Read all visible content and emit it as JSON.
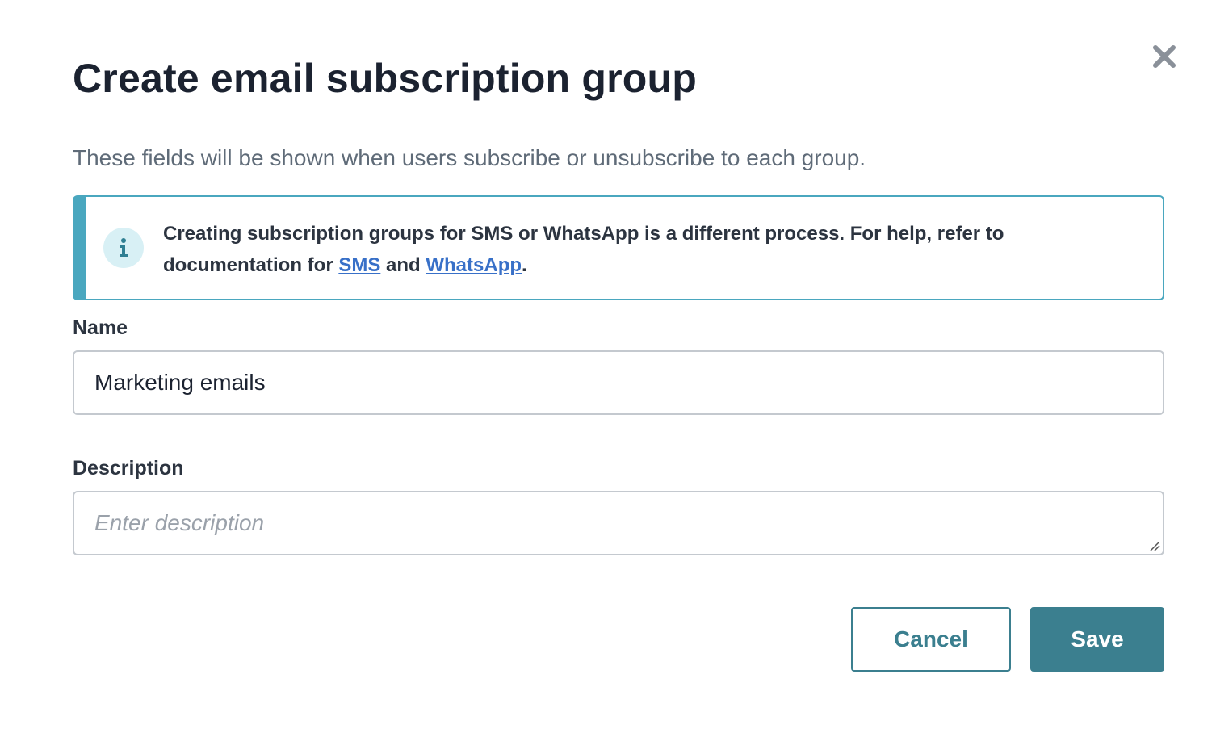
{
  "dialog": {
    "title": "Create email subscription group",
    "subtitle": "These fields will be shown when users subscribe or unsubscribe to each group.",
    "close_icon": "close-icon"
  },
  "callout": {
    "icon": "info-icon",
    "text_part1": "Creating subscription groups for SMS or WhatsApp is a different process. For help, refer to documentation for ",
    "link_sms": "SMS",
    "text_and": " and ",
    "link_whatsapp": "WhatsApp",
    "text_end": "."
  },
  "form": {
    "name_label": "Name",
    "name_value": "Marketing emails",
    "description_label": "Description",
    "description_placeholder": "Enter description"
  },
  "actions": {
    "cancel_label": "Cancel",
    "save_label": "Save"
  },
  "colors": {
    "accent": "#3b7f8f",
    "callout_border": "#4aa7bf",
    "link": "#3870c8"
  }
}
